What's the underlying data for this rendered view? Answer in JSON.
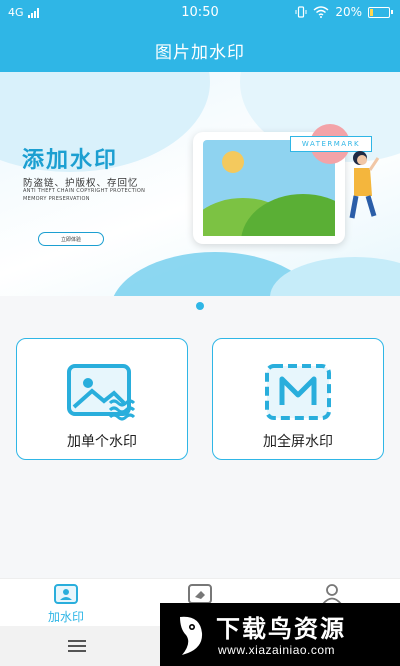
{
  "status": {
    "network": "4G",
    "time": "10:50",
    "battery_text": "20%",
    "battery_level": 0.2
  },
  "header": {
    "title": "图片加水印"
  },
  "banner": {
    "title": "添加水印",
    "subtitle": "防盗链、护版权、存回忆",
    "en_line1": "ANTI THEFT CHAIN  COPYRIGHT PROTECTION",
    "en_line2": "MEMORY PRESERVATION",
    "button_label": "立即体验",
    "tag": "WATERMARK"
  },
  "carousel": {
    "active_index": 0,
    "count": 1
  },
  "cards": {
    "single": {
      "label": "加单个水印",
      "icon": "image-wave-icon"
    },
    "fullscreen": {
      "label": "加全屏水印",
      "icon": "dashed-m-icon"
    }
  },
  "tabs": [
    {
      "label": "加水印",
      "icon": "user-card-icon",
      "active": true
    },
    {
      "label": "",
      "icon": "eraser-icon",
      "active": false
    },
    {
      "label": "",
      "icon": "profile-icon",
      "active": false
    }
  ],
  "overlay": {
    "title": "下载鸟资源",
    "url": "www.xiazainiao.com"
  },
  "colors": {
    "accent": "#2fb6e6",
    "overlay_bg": "#000000"
  }
}
